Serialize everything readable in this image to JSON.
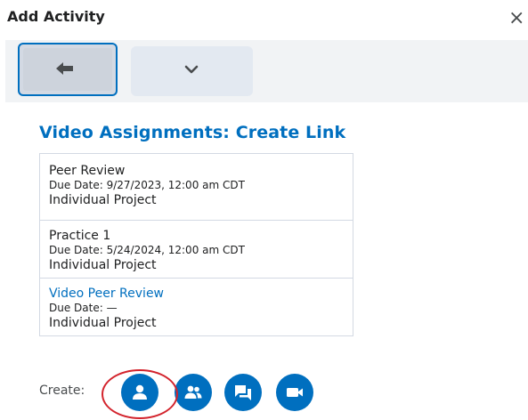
{
  "dialog": {
    "title": "Add Activity",
    "close_icon": "×"
  },
  "toolbar": {
    "back_icon": "arrow-left-icon",
    "more_icon": "chevron-down-icon"
  },
  "section": {
    "heading": "Video Assignments: Create Link"
  },
  "assignments": [
    {
      "name": "Peer Review",
      "due": "Due Date: 9/27/2023, 12:00 am CDT",
      "type": "Individual Project"
    },
    {
      "name": "Practice 1",
      "due": "Due Date: 5/24/2024, 12:00 am CDT",
      "type": "Individual Project"
    },
    {
      "name": "Video Peer Review",
      "due": "Due Date: —",
      "type": "Individual Project"
    }
  ],
  "create": {
    "label": "Create:",
    "buttons": [
      "individual-icon",
      "group-icon",
      "discussion-icon",
      "video-icon"
    ]
  },
  "colors": {
    "accent": "#006fbf",
    "highlight_ring": "#d3232c"
  }
}
